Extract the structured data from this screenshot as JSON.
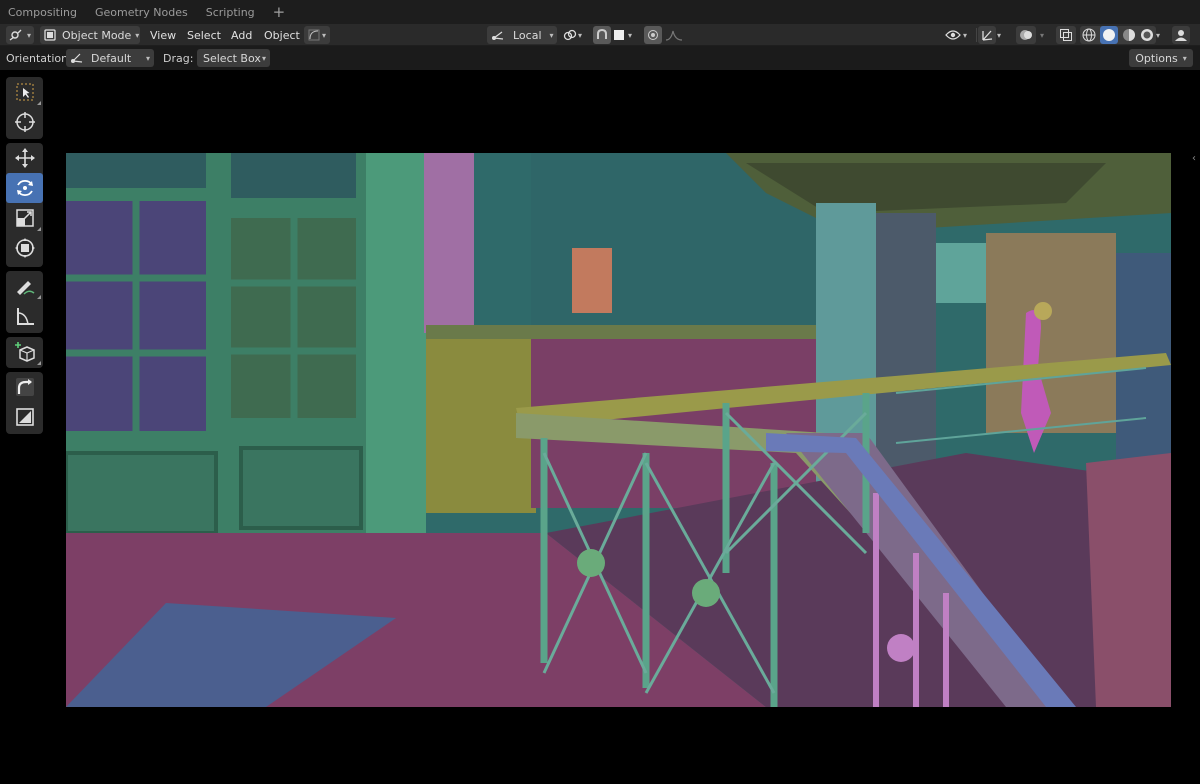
{
  "workspace_tabs": [
    "Compositing",
    "Geometry Nodes",
    "Scripting"
  ],
  "tab_add_symbol": "+",
  "header": {
    "mode": "Object Mode",
    "menus": [
      "View",
      "Select",
      "Add",
      "Object"
    ],
    "transform_pivot": "Local"
  },
  "tool_settings": {
    "orientation_label": "Orientation:",
    "orientation_value": "Default",
    "drag_label": "Drag:",
    "drag_value": "Select Box",
    "options_label": "Options"
  },
  "toolbar": {
    "active_tool": "rotate",
    "tools": [
      "select-box",
      "cursor",
      "move",
      "rotate",
      "scale",
      "transform",
      "annotate",
      "measure",
      "add-cube",
      "shear",
      "extrude"
    ]
  },
  "colors": {
    "accent": "#4772b3",
    "header_bg": "#2a2a2a",
    "viewport_bg": "#000000"
  },
  "icons": [
    "viewport-editor-icon",
    "object-mode-icon",
    "transform-pivot-icon",
    "snap-icon",
    "proportional-edit-icon",
    "visibility-icon",
    "gizmo-icon",
    "overlay-icon",
    "xray-icon",
    "wireframe-shading-icon",
    "solid-shading-icon",
    "material-shading-icon",
    "rendered-shading-icon"
  ]
}
